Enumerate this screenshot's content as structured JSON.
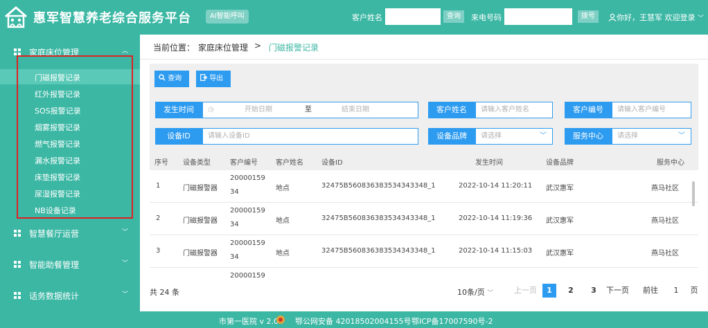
{
  "header": {
    "title": "惠军智慧养老综合服务平台",
    "ai_call": "AI智能呼叫",
    "customer_name_label": "客户姓名",
    "query_btn": "查询",
    "caller_label": "来电号码",
    "dial_btn": "拨号",
    "user_greeting": "你好，王慧军 欢迎登录"
  },
  "sidebar": {
    "groups": [
      {
        "label": "家庭床位管理"
      },
      {
        "label": "智慧餐厅运营"
      },
      {
        "label": "智能助餐管理"
      },
      {
        "label": "话务数据统计"
      }
    ],
    "sub_items": [
      {
        "label": "门磁报警记录"
      },
      {
        "label": "红外报警记录"
      },
      {
        "label": "SOS报警记录"
      },
      {
        "label": "烟雾报警记录"
      },
      {
        "label": "燃气报警记录"
      },
      {
        "label": "漏水报警记录"
      },
      {
        "label": "床垫报警记录"
      },
      {
        "label": "尿湿报警记录"
      },
      {
        "label": "NB设备记录"
      }
    ]
  },
  "breadcrumb": {
    "prefix": "当前位置：",
    "parent": "家庭床位管理",
    "current": "门磁报警记录"
  },
  "toolbar": {
    "query": "查询",
    "export": "导出"
  },
  "filters": {
    "time_label": "发生时间",
    "start_ph": "开始日期",
    "to": "至",
    "end_ph": "结束日期",
    "cust_name_label": "客户姓名",
    "cust_name_ph": "请输入客户姓名",
    "cust_id_label": "客户编号",
    "cust_id_ph": "请输入客户编号",
    "device_id_label": "设备ID",
    "device_id_ph": "请输入设备ID",
    "brand_label": "设备品牌",
    "brand_ph": "请选择",
    "center_label": "服务中心",
    "center_ph": "请选择"
  },
  "table": {
    "headers": [
      "序号",
      "设备类型",
      "客户编号",
      "客户姓名",
      "设备ID",
      "发生时间",
      "设备品牌",
      "服务中心"
    ],
    "rows": [
      {
        "idx": "1",
        "type": "门磁报警器",
        "cid1": "20000159",
        "cid2": "34",
        "name": "地点",
        "device": "32475B560836383534343348_1",
        "time": "2022-10-14 11:20:11",
        "brand": "武汉惠军",
        "center": "燕马社区"
      },
      {
        "idx": "2",
        "type": "门磁报警器",
        "cid1": "20000159",
        "cid2": "34",
        "name": "地点",
        "device": "32475B560836383534343348_1",
        "time": "2022-10-14 11:19:36",
        "brand": "武汉惠军",
        "center": "燕马社区"
      },
      {
        "idx": "3",
        "type": "门磁报警器",
        "cid1": "20000159",
        "cid2": "34",
        "name": "地点",
        "device": "32475B560836383534343348_1",
        "time": "2022-10-14 11:15:03",
        "brand": "武汉惠军",
        "center": "燕马社区"
      },
      {
        "idx": "",
        "type": "",
        "cid1": "20000159",
        "cid2": "",
        "name": "",
        "device": "",
        "time": "",
        "brand": "",
        "center": ""
      }
    ]
  },
  "pager": {
    "total": "共 24 条",
    "page_size": "10条/页",
    "prev": "上一页",
    "pages": [
      "1",
      "2",
      "3"
    ],
    "next": "下一页",
    "goto": "前往",
    "goto_value": "1",
    "page_unit": "页"
  },
  "footer": {
    "left": "市第一医院 v 2.0",
    "middle": "鄂公网安备 42018502004155号",
    "right": "鄂ICP备17007590号-2"
  }
}
